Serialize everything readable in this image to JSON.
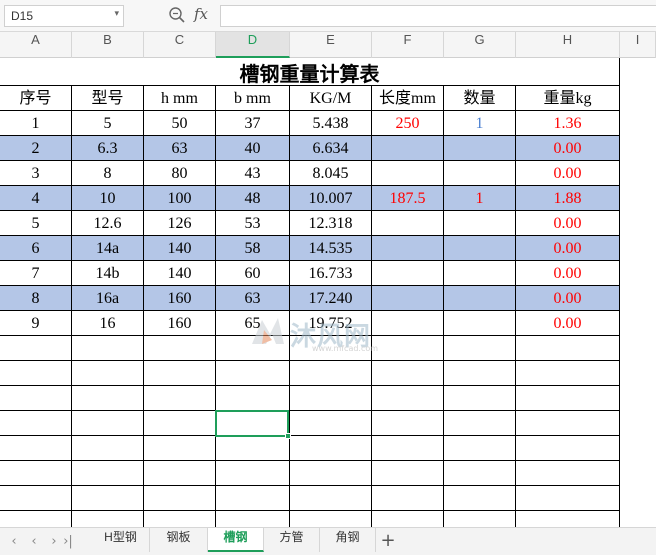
{
  "formula_bar": {
    "name_box": "D15",
    "fx": "fx",
    "formula": ""
  },
  "columns": [
    "A",
    "B",
    "C",
    "D",
    "E",
    "F",
    "G",
    "H",
    "I"
  ],
  "selected_column": "D",
  "table": {
    "title": "槽钢重量计算表",
    "headers": [
      "序号",
      "型号",
      "h mm",
      "b mm",
      "KG/M",
      "长度mm",
      "数量",
      "重量kg"
    ],
    "rows": [
      {
        "no": "1",
        "model": "5",
        "h": "50",
        "b": "37",
        "kgm": "5.438",
        "length": "250",
        "qty": "1",
        "weight": "1.36"
      },
      {
        "no": "2",
        "model": "6.3",
        "h": "63",
        "b": "40",
        "kgm": "6.634",
        "length": "",
        "qty": "",
        "weight": "0.00"
      },
      {
        "no": "3",
        "model": "8",
        "h": "80",
        "b": "43",
        "kgm": "8.045",
        "length": "",
        "qty": "",
        "weight": "0.00"
      },
      {
        "no": "4",
        "model": "10",
        "h": "100",
        "b": "48",
        "kgm": "10.007",
        "length": "187.5",
        "qty": "1",
        "weight": "1.88"
      },
      {
        "no": "5",
        "model": "12.6",
        "h": "126",
        "b": "53",
        "kgm": "12.318",
        "length": "",
        "qty": "",
        "weight": "0.00"
      },
      {
        "no": "6",
        "model": "14a",
        "h": "140",
        "b": "58",
        "kgm": "14.535",
        "length": "",
        "qty": "",
        "weight": "0.00"
      },
      {
        "no": "7",
        "model": "14b",
        "h": "140",
        "b": "60",
        "kgm": "16.733",
        "length": "",
        "qty": "",
        "weight": "0.00"
      },
      {
        "no": "8",
        "model": "16a",
        "h": "160",
        "b": "63",
        "kgm": "17.240",
        "length": "",
        "qty": "",
        "weight": "0.00"
      },
      {
        "no": "9",
        "model": "16",
        "h": "160",
        "b": "65",
        "kgm": "19.752",
        "length": "",
        "qty": "",
        "weight": "0.00"
      }
    ]
  },
  "watermark": {
    "text": "沐风网",
    "sub": "www.mfcad.com"
  },
  "sheet_tabs": [
    "H型钢",
    "钢板",
    "槽钢",
    "方管",
    "角钢"
  ],
  "active_tab": "槽钢",
  "colors": {
    "accent": "#1e9e5a",
    "band": "#b4c6e7",
    "red": "#ff0000",
    "blue": "#4a7fd0"
  }
}
